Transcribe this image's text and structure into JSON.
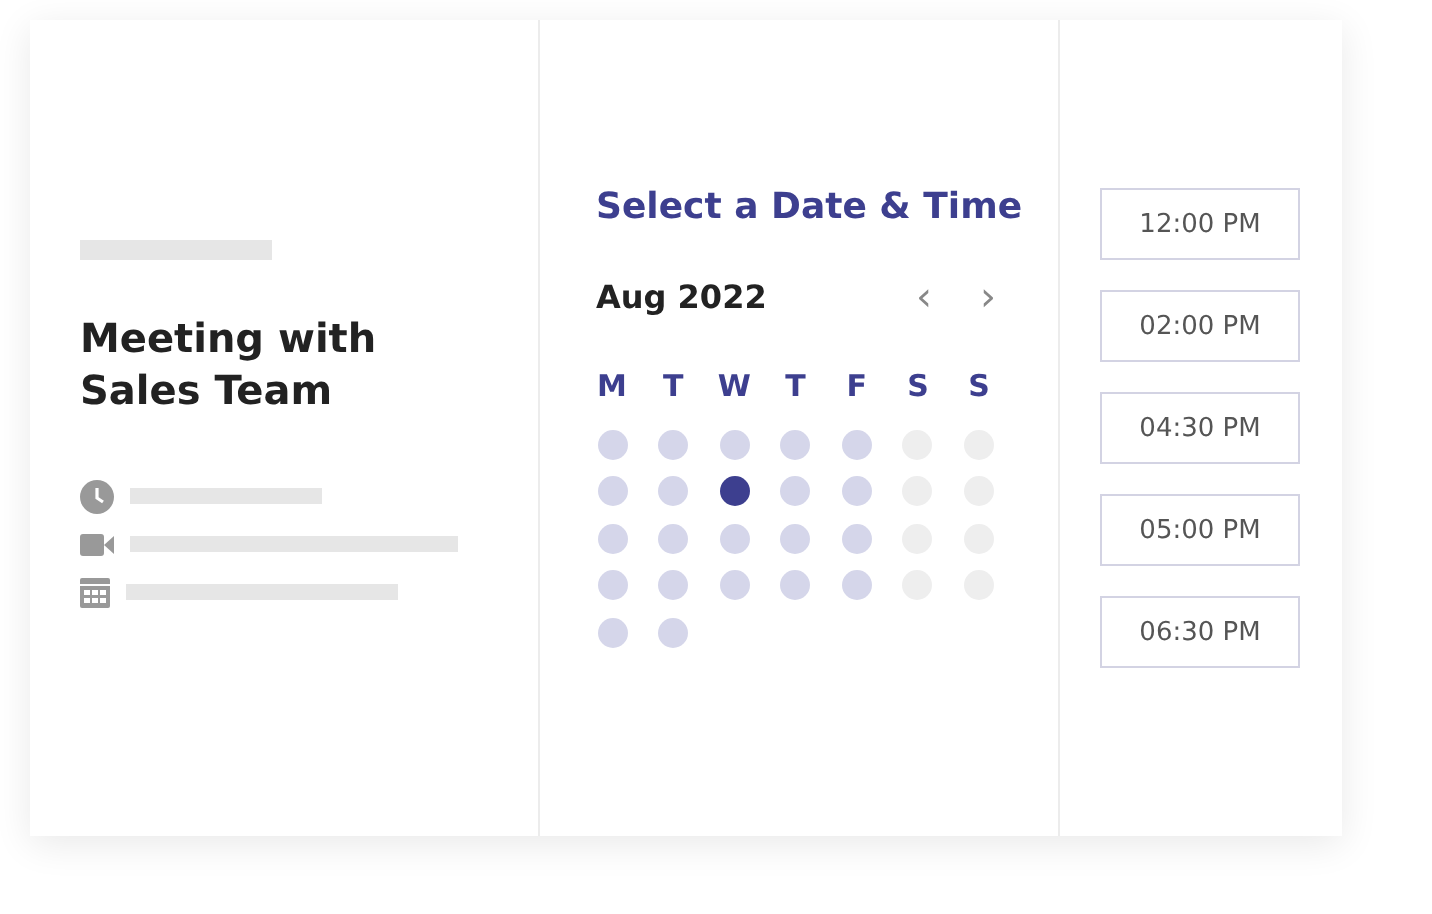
{
  "event": {
    "title": "Meeting with Sales Team"
  },
  "picker": {
    "heading": "Select a Date & Time",
    "month": "Aug 2022",
    "prev": "‹",
    "next": "›",
    "weekdays": [
      "M",
      "T",
      "W",
      "T",
      "F",
      "S",
      "S"
    ],
    "days": [
      {
        "available": true,
        "selected": false
      },
      {
        "available": true,
        "selected": false
      },
      {
        "available": true,
        "selected": false
      },
      {
        "available": true,
        "selected": false
      },
      {
        "available": true,
        "selected": false
      },
      {
        "available": false,
        "selected": false
      },
      {
        "available": false,
        "selected": false
      },
      {
        "available": true,
        "selected": false
      },
      {
        "available": true,
        "selected": false
      },
      {
        "available": true,
        "selected": true
      },
      {
        "available": true,
        "selected": false
      },
      {
        "available": true,
        "selected": false
      },
      {
        "available": false,
        "selected": false
      },
      {
        "available": false,
        "selected": false
      },
      {
        "available": true,
        "selected": false
      },
      {
        "available": true,
        "selected": false
      },
      {
        "available": true,
        "selected": false
      },
      {
        "available": true,
        "selected": false
      },
      {
        "available": true,
        "selected": false
      },
      {
        "available": false,
        "selected": false
      },
      {
        "available": false,
        "selected": false
      },
      {
        "available": true,
        "selected": false
      },
      {
        "available": true,
        "selected": false
      },
      {
        "available": true,
        "selected": false
      },
      {
        "available": true,
        "selected": false
      },
      {
        "available": true,
        "selected": false
      },
      {
        "available": false,
        "selected": false
      },
      {
        "available": false,
        "selected": false
      },
      {
        "available": true,
        "selected": false
      },
      {
        "available": true,
        "selected": false
      }
    ]
  },
  "times": [
    "12:00 PM",
    "02:00 PM",
    "04:30 PM",
    "05:00 PM",
    "06:30 PM"
  ]
}
